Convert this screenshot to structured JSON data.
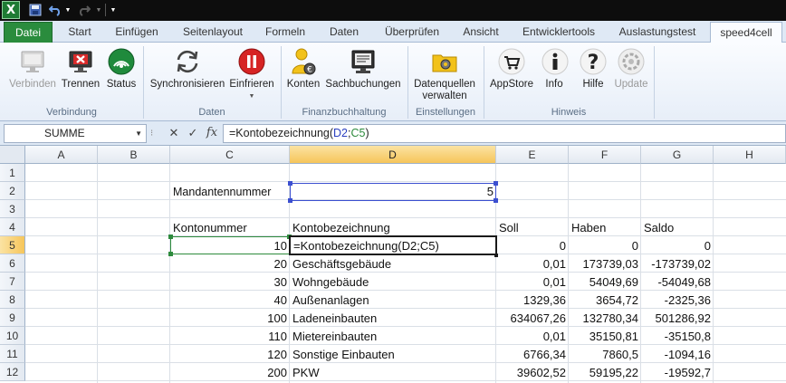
{
  "window": {
    "quick_access": [
      "excel-logo",
      "save-icon",
      "undo-icon",
      "redo-icon",
      "customize-icon"
    ]
  },
  "tabs": [
    {
      "label": "Datei"
    },
    {
      "label": "Start"
    },
    {
      "label": "Einfügen"
    },
    {
      "label": "Seitenlayout"
    },
    {
      "label": "Formeln"
    },
    {
      "label": "Daten"
    },
    {
      "label": "Überprüfen"
    },
    {
      "label": "Ansicht"
    },
    {
      "label": "Entwicklertools"
    },
    {
      "label": "Auslastungstest"
    },
    {
      "label": "speed4cell"
    }
  ],
  "ribbon": {
    "buttons": [
      {
        "label": "Verbinden",
        "icon": "monitor-icon",
        "enabled": false
      },
      {
        "label": "Trennen",
        "icon": "disconnect-icon",
        "enabled": true
      },
      {
        "label": "Status",
        "icon": "status-icon",
        "enabled": true
      },
      {
        "label": "Synchronisieren",
        "icon": "sync-icon",
        "enabled": true
      },
      {
        "label": "Einfrieren",
        "icon": "pause-icon",
        "enabled": true
      },
      {
        "label": "Konten",
        "icon": "account-user-icon",
        "enabled": true
      },
      {
        "label": "Sachbuchungen",
        "icon": "bookings-icon",
        "enabled": true
      },
      {
        "label": "Datenquellen",
        "label2": "verwalten",
        "icon": "datasource-icon",
        "enabled": true
      },
      {
        "label": "AppStore",
        "icon": "cart-icon",
        "enabled": true
      },
      {
        "label": "Info",
        "icon": "info-icon",
        "enabled": true
      },
      {
        "label": "Hilfe",
        "icon": "help-icon",
        "enabled": true
      },
      {
        "label": "Update",
        "icon": "update-icon",
        "enabled": false
      }
    ],
    "groups": [
      "Verbindung",
      "Daten",
      "Finanzbuchhaltung",
      "Einstellungen",
      "Hinweis"
    ]
  },
  "formula_bar": {
    "name_box": "SUMME",
    "formula_prefix": "=Kontobezeichnung(",
    "formula_ref1": "D2",
    "formula_sep": ";",
    "formula_ref2": "C5",
    "formula_suffix": ")"
  },
  "sheet": {
    "columns": [
      "A",
      "B",
      "C",
      "D",
      "E",
      "F",
      "G",
      "H"
    ],
    "rows": [
      "1",
      "2",
      "3",
      "4",
      "5",
      "6",
      "7",
      "8",
      "9",
      "10",
      "11",
      "12"
    ],
    "mandant_label": "Mandantennummer",
    "mandant_value": "5",
    "headers": {
      "kontonummer": "Kontonummer",
      "kontobezeichnung": "Kontobezeichnung",
      "soll": "Soll",
      "haben": "Haben",
      "saldo": "Saldo"
    },
    "data_rows": [
      {
        "konto": "10",
        "bez": "=Kontobezeichnung(D2;C5)",
        "soll": "0",
        "haben": "0",
        "saldo": "0"
      },
      {
        "konto": "20",
        "bez": "Geschäftsgebäude",
        "soll": "0,01",
        "haben": "173739,03",
        "saldo": "-173739,02"
      },
      {
        "konto": "30",
        "bez": "Wohngebäude",
        "soll": "0,01",
        "haben": "54049,69",
        "saldo": "-54049,68"
      },
      {
        "konto": "40",
        "bez": "Außenanlagen",
        "soll": "1329,36",
        "haben": "3654,72",
        "saldo": "-2325,36"
      },
      {
        "konto": "100",
        "bez": "Ladeneinbauten",
        "soll": "634067,26",
        "haben": "132780,34",
        "saldo": "501286,92"
      },
      {
        "konto": "110",
        "bez": "Mietereinbauten",
        "soll": "0,01",
        "haben": "35150,81",
        "saldo": "-35150,8"
      },
      {
        "konto": "120",
        "bez": "Sonstige Einbauten",
        "soll": "6766,34",
        "haben": "7860,5",
        "saldo": "-1094,16"
      },
      {
        "konto": "200",
        "bez": "PKW",
        "soll": "39602,52",
        "haben": "59195,22",
        "saldo": "-19592,7"
      }
    ]
  }
}
